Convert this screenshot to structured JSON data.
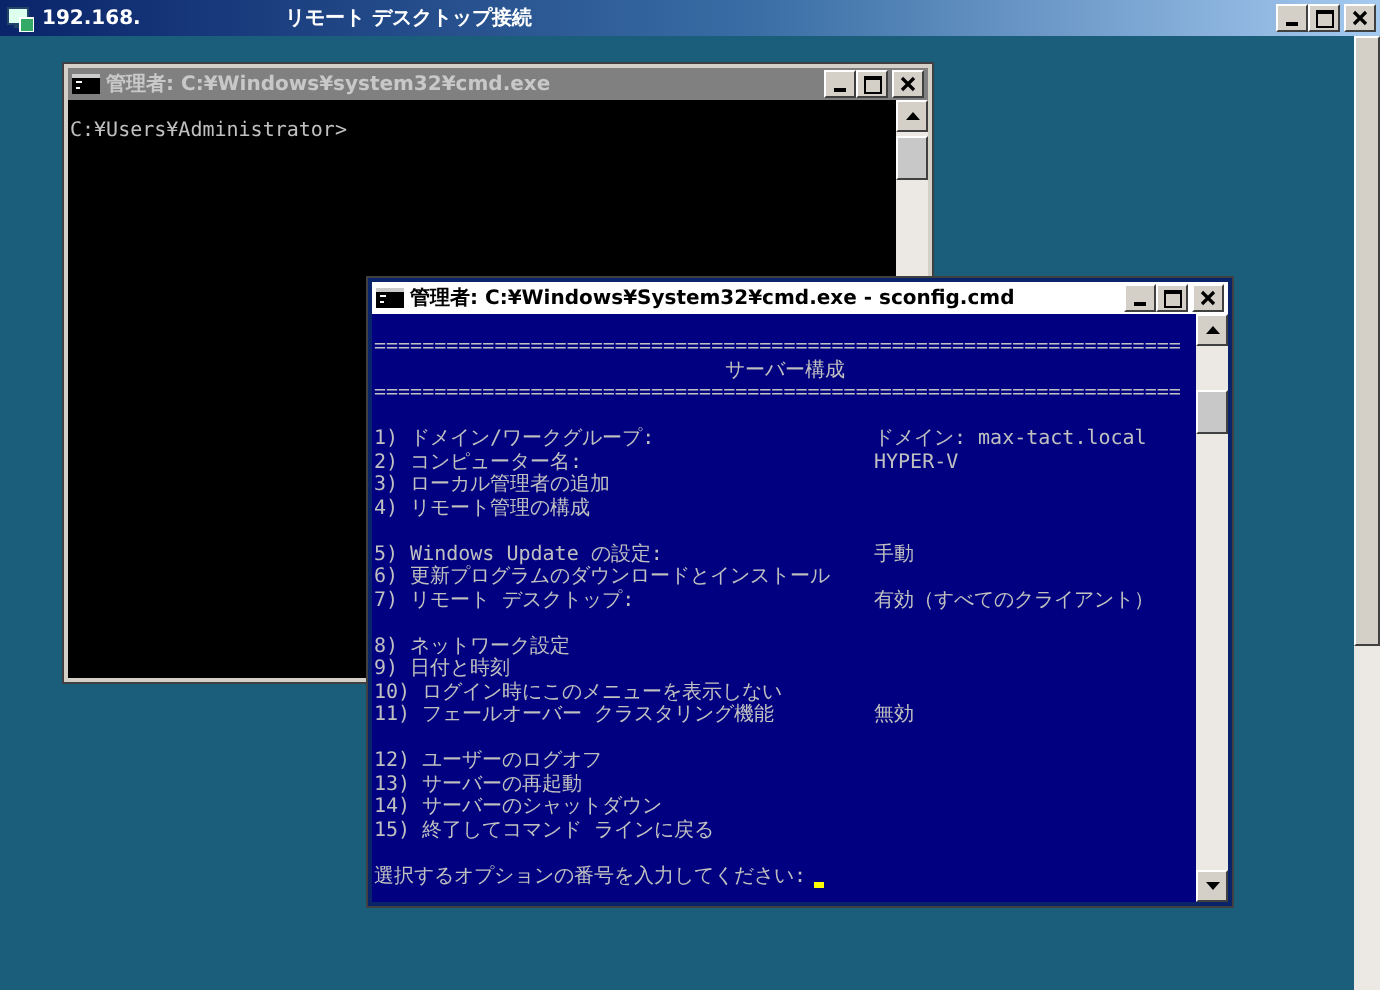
{
  "rdp": {
    "address": "192.168.",
    "title": "リモート デスクトップ接続"
  },
  "back_window": {
    "title": "管理者: C:¥Windows¥system32¥cmd.exe",
    "active": false,
    "prompt": "C:¥Users¥Administrator>"
  },
  "front_window": {
    "title": "管理者: C:¥Windows¥System32¥cmd.exe - sconfig.cmd",
    "active": true,
    "separator": "===================================================================",
    "heading": "サーバー構成",
    "groups": [
      [
        {
          "label": "1) ドメイン/ワークグループ:",
          "value": "ドメイン:  max-tact.local"
        },
        {
          "label": "2) コンピューター名:",
          "value": "HYPER-V"
        },
        {
          "label": "3) ローカル管理者の追加"
        },
        {
          "label": "4) リモート管理の構成"
        }
      ],
      [
        {
          "label": "5) Windows Update の設定:",
          "value": "   手動"
        },
        {
          "label": "6) 更新プログラムのダウンロードとインストール"
        },
        {
          "label": "7) リモート デスクトップ:",
          "value": "   有効（すべてのクライアント）"
        }
      ],
      [
        {
          "label": "8) ネットワーク設定"
        },
        {
          "label": "9) 日付と時刻"
        },
        {
          "label": "10) ログイン時にこのメニューを表示しない"
        },
        {
          "label": "11) フェールオーバー クラスタリング機能",
          "value": "無効"
        }
      ],
      [
        {
          "label": "12) ユーザーのログオフ"
        },
        {
          "label": "13) サーバーの再起動"
        },
        {
          "label": "14) サーバーのシャットダウン"
        },
        {
          "label": "15) 終了してコマンド ラインに戻る"
        }
      ]
    ],
    "prompt": "選択するオプションの番号を入力してください:"
  }
}
